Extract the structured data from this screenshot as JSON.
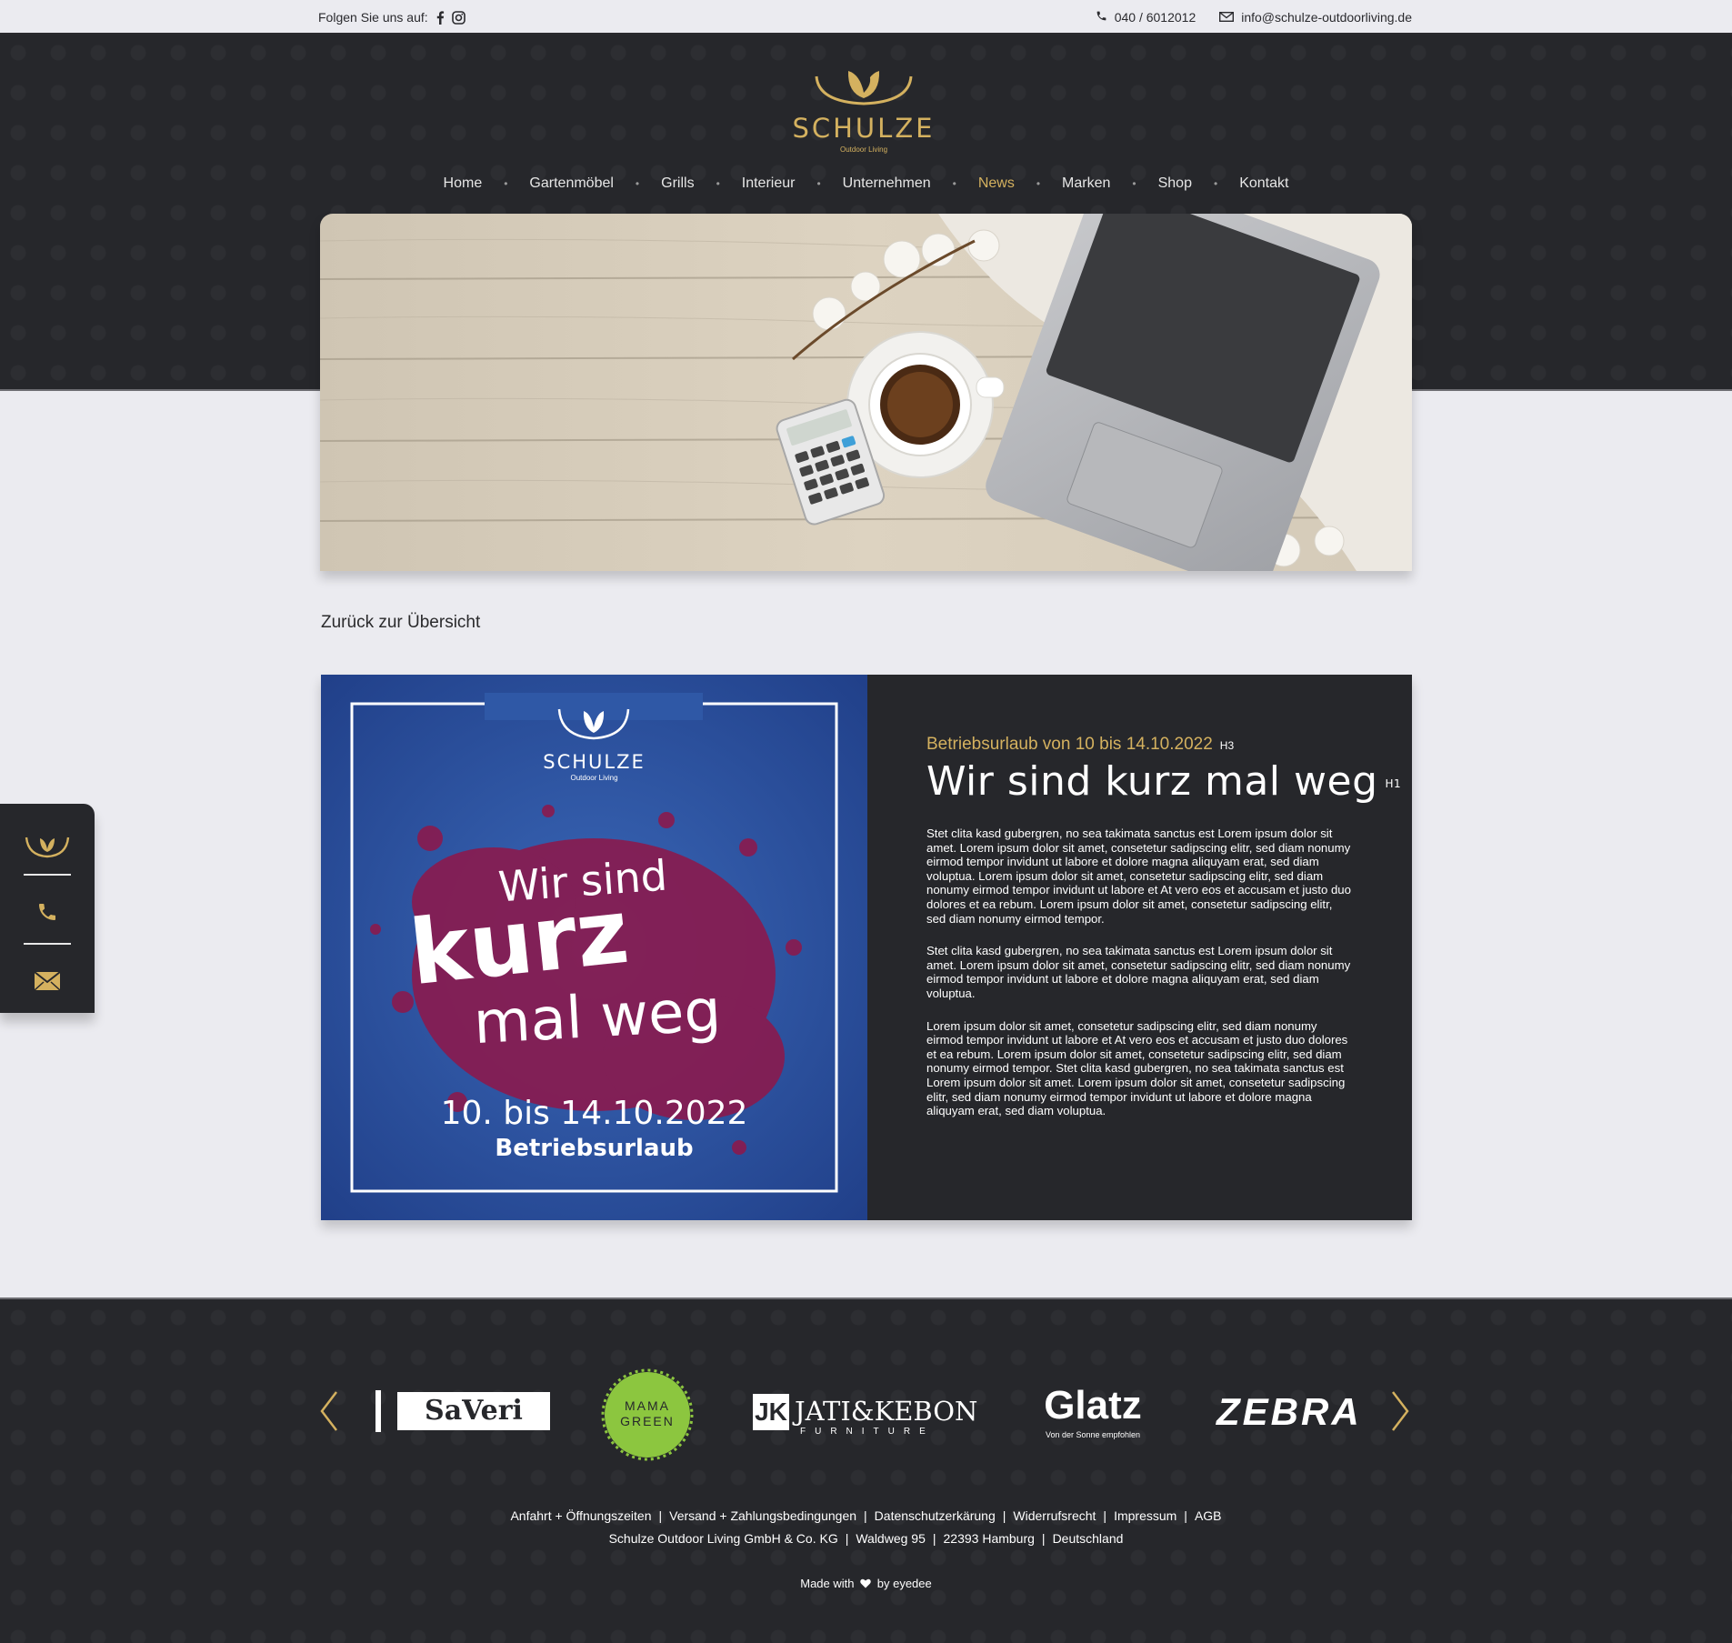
{
  "topbar": {
    "follow_label": "Folgen Sie uns auf:",
    "phone": "040 / 6012012",
    "email": "info@schulze-outdoorliving.de"
  },
  "logo": {
    "brand": "SCHULZE",
    "subline": "Outdoor Living"
  },
  "nav": {
    "items": [
      "Home",
      "Gartenmöbel",
      "Grills",
      "Interieur",
      "Unternehmen",
      "News",
      "Marken",
      "Shop",
      "Kontakt"
    ],
    "active": "News"
  },
  "back_link": "Zurück zur Übersicht",
  "article": {
    "h3": "Betriebsurlaub von 10 bis 14.10.2022",
    "h3_tag": "H3",
    "h1": "Wir sind kurz mal weg",
    "h1_tag": "H1",
    "paragraphs": [
      "Stet clita kasd gubergren, no sea takimata sanctus est Lorem ipsum dolor sit amet. Lorem ipsum dolor sit amet, consetetur sadipscing elitr, sed diam nonumy eirmod tempor invidunt ut labore et dolore magna aliquyam erat, sed diam voluptua. Lorem ipsum dolor sit amet, consetetur sadipscing elitr, sed diam nonumy eirmod tempor invidunt ut labore et At vero eos et accusam et justo duo dolores et ea rebum. Lorem ipsum dolor sit amet, consetetur sadipscing elitr, sed diam nonumy eirmod tempor.",
      "Stet clita kasd gubergren, no sea takimata sanctus est Lorem ipsum dolor sit amet. Lorem ipsum dolor sit amet, consetetur sadipscing elitr, sed diam nonumy eirmod tempor invidunt ut labore et dolore magna aliquyam erat, sed diam voluptua.",
      "Lorem ipsum dolor sit amet, consetetur sadipscing elitr, sed diam nonumy eirmod tempor invidunt ut labore et At vero eos et accusam et justo duo dolores et ea rebum. Lorem ipsum dolor sit amet, consetetur sadipscing elitr, sed diam nonumy eirmod tempor. Stet clita kasd gubergren, no sea takimata sanctus est Lorem ipsum dolor sit amet. Lorem ipsum dolor sit amet, consetetur sadipscing elitr, sed diam nonumy eirmod tempor invidunt ut labore et dolore magna aliquyam erat, sed diam voluptua."
    ],
    "poster": {
      "brand": "SCHULZE",
      "subline": "Outdoor Living",
      "line1": "Wir sind",
      "line2": "kurz",
      "line3": "mal weg",
      "dates": "10. bis 14.10.2022",
      "caption": "Betriebsurlaub"
    }
  },
  "brands": [
    "SaVeri",
    "MAMA GREEN",
    "JATI&KEBON",
    "FURNITURE",
    "Glatz",
    "Von der Sonne empfohlen",
    "ZEBRA"
  ],
  "footer": {
    "links": [
      "Anfahrt + Öffnungszeiten",
      "Versand + Zahlungsbedingungen",
      "Datenschutzerkärung",
      "Widerrufsrecht",
      "Impressum",
      "AGB"
    ],
    "address": [
      "Schulze Outdoor Living GmbH & Co. KG",
      "Waldweg 95",
      "22393 Hamburg",
      "Deutschland"
    ],
    "made_prefix": "Made with",
    "made_suffix": "by eyedee"
  },
  "colors": {
    "gold": "#d4b15f",
    "dark": "#26272b",
    "page_bg": "#ebebf0",
    "poster_blue": "#2b4f9a",
    "poster_magenta": "#8a1a4e",
    "mama_green": "#8cc63f"
  },
  "icons": [
    "facebook-icon",
    "instagram-icon",
    "phone-icon",
    "mail-icon",
    "leaf-logo-icon",
    "chevron-left-icon",
    "chevron-right-icon",
    "heart-icon"
  ]
}
